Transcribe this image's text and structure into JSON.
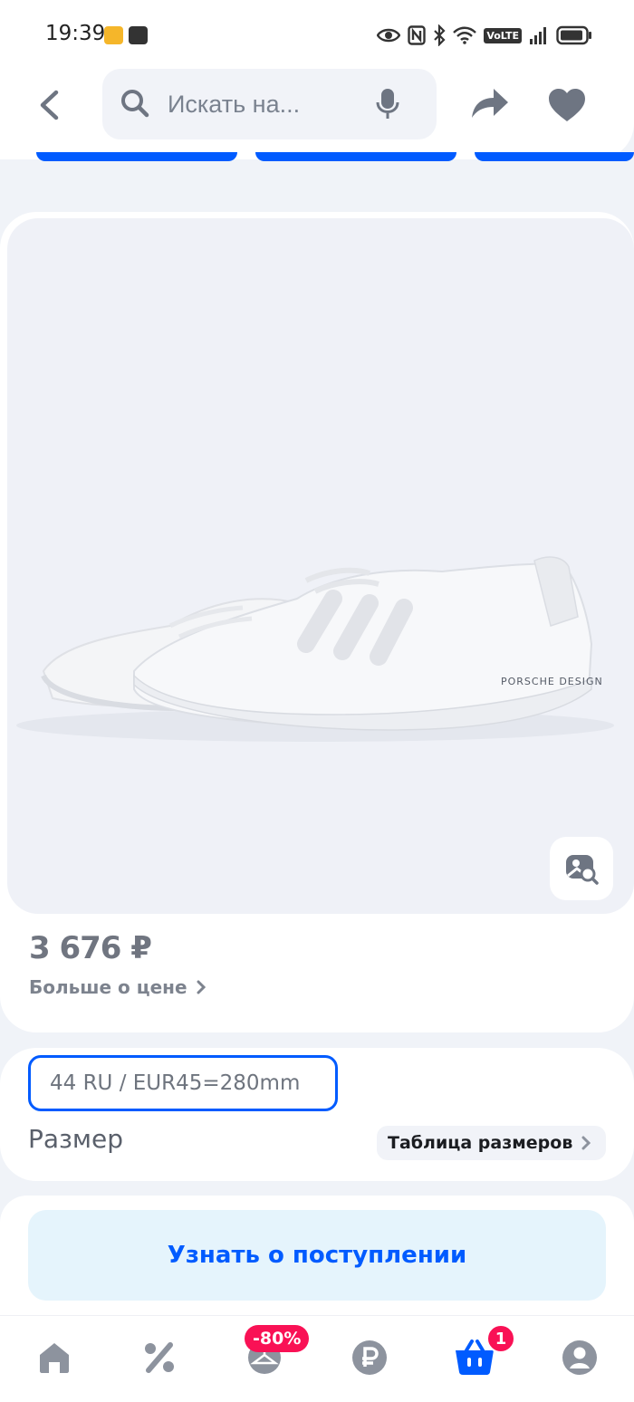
{
  "status_bar": {
    "time": "19:39",
    "network": "VoLTE"
  },
  "header": {
    "back_icon": "chevron-left-icon",
    "search_placeholder": "Искать на...",
    "search_icon": "search-icon",
    "mic_icon": "microphone-icon",
    "share_icon": "share-icon",
    "favorite_icon": "heart-icon"
  },
  "product": {
    "image_alt": "white sneakers",
    "image_brand_print": "PORSCHE DESIGN",
    "price": "3 676 ₽",
    "price_more_label": "Больше о цене"
  },
  "size": {
    "selected": "44 RU / EUR45=280mm",
    "label": "Размер",
    "table_button": "Таблица размеров"
  },
  "cta": {
    "notify_label": "Узнать о поступлении"
  },
  "bottom_nav": {
    "items": [
      "home",
      "discounts",
      "wardrobe",
      "payments",
      "cart",
      "profile"
    ],
    "sale_badge": "-80%",
    "cart_count": "1",
    "colors": {
      "active": "#005bff",
      "inactive": "#8d939e",
      "badge": "#f91155"
    }
  }
}
